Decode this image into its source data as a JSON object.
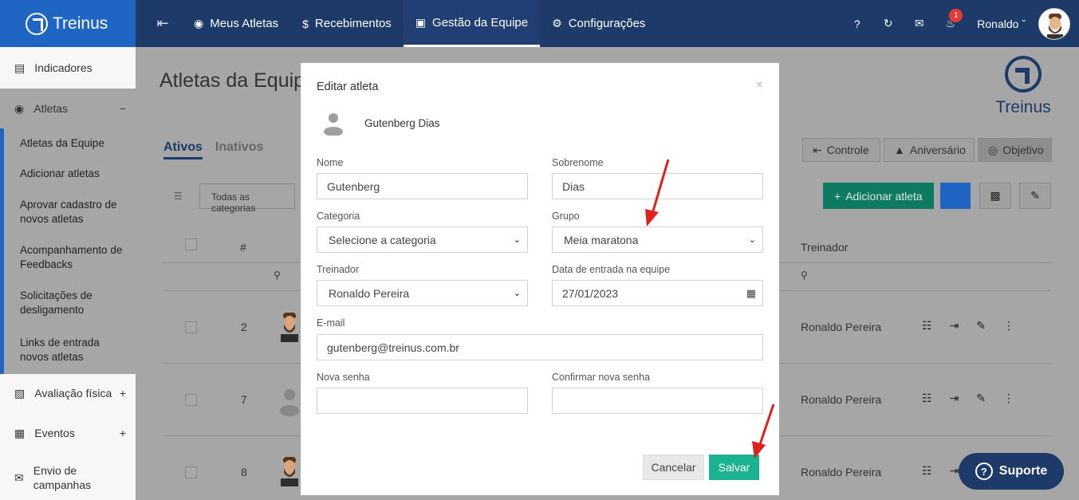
{
  "brand": "Treinus",
  "nav": {
    "items": [
      {
        "label": "Meus Atletas",
        "icon": "medal-icon"
      },
      {
        "label": "Recebimentos",
        "icon": "dollar-icon"
      },
      {
        "label": "Gestão da Equipe",
        "icon": "id-card-icon"
      },
      {
        "label": "Configurações",
        "icon": "gears-icon"
      }
    ],
    "active": "Gestão da Equipe",
    "notification_count": "1",
    "user_name": "Ronaldo"
  },
  "sidebar": {
    "items": [
      {
        "label": "Indicadores"
      },
      {
        "label": "Atletas"
      },
      {
        "label": "Avaliação física"
      },
      {
        "label": "Eventos"
      },
      {
        "label": "Envio de campanhas"
      }
    ],
    "sub_items": [
      "Atletas da Equipe",
      "Adicionar atletas",
      "Aprovar cadastro de novos atletas",
      "Acompanhamento de Feedbacks",
      "Solicitações de desligamento",
      "Links de entrada novos atletas"
    ]
  },
  "main": {
    "title": "Atletas da Equipe",
    "logo_text": "Treinus",
    "tabs": [
      "Ativos",
      "Inativos"
    ],
    "buttons": {
      "controle": "Controle",
      "aniversario": "Aniversário",
      "objetivo": "Objetivo",
      "add_athlete": "Adicionar atleta"
    },
    "filter_category": "Todas as categorias",
    "table": {
      "headers": {
        "num": "#",
        "trainer": "Treinador"
      },
      "rows": [
        {
          "num": "2",
          "trainer": "Ronaldo Pereira"
        },
        {
          "num": "7",
          "trainer": "Ronaldo Pereira"
        },
        {
          "num": "8",
          "trainer": "Ronaldo Pereira"
        }
      ]
    }
  },
  "modal": {
    "title": "Editar atleta",
    "athlete_name": "Gutenberg Dias",
    "fields": {
      "nome": {
        "label": "Nome",
        "value": "Gutenberg"
      },
      "sobrenome": {
        "label": "Sobrenome",
        "value": "Dias"
      },
      "categoria": {
        "label": "Categoria",
        "value": "Selecione a categoria"
      },
      "grupo": {
        "label": "Grupo",
        "value": "Meia maratona"
      },
      "treinador": {
        "label": "Treinador",
        "value": "Ronaldo Pereira"
      },
      "data_entrada": {
        "label": "Data de entrada na equipe",
        "value": "27/01/2023"
      },
      "email": {
        "label": "E-mail",
        "value": "gutenberg@treinus.com.br"
      },
      "nova_senha": {
        "label": "Nova senha",
        "value": ""
      },
      "confirmar_senha": {
        "label": "Confirmar nova senha",
        "value": ""
      }
    },
    "cancel_label": "Cancelar",
    "save_label": "Salvar"
  },
  "support_label": "Suporte",
  "colors": {
    "nav_bg": "#1e3a68",
    "brand_bg": "#1f65c4",
    "save_green": "#1bb38f",
    "arrow_red": "#e0201b"
  }
}
